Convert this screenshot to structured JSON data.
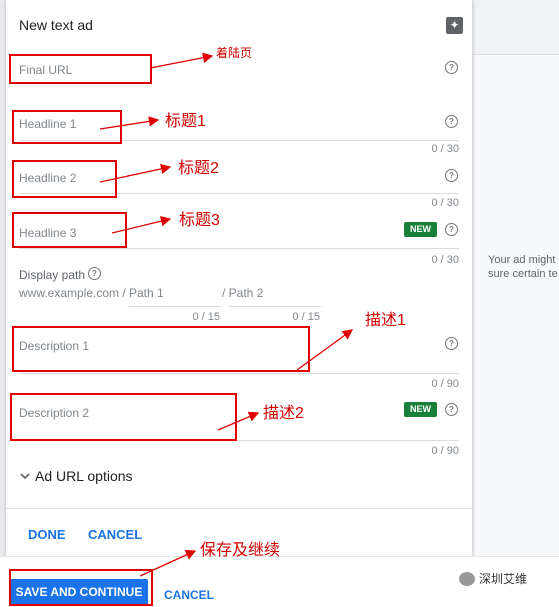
{
  "ad": {
    "title": "New text ad",
    "final_url_label": "Final URL",
    "headline1_label": "Headline 1",
    "headline1_count": "0 / 30",
    "headline2_label": "Headline 2",
    "headline2_count": "0 / 30",
    "headline3_label": "Headline 3",
    "headline3_badge": "NEW",
    "headline3_count": "0 / 30",
    "display_path_label": "Display path",
    "display_path_domain": "www.example.com /",
    "path1_label": "Path 1",
    "path2_label": "/ Path 2",
    "path1_count": "0 / 15",
    "path2_count": "0 / 15",
    "description1_label": "Description 1",
    "description1_count": "0 / 90",
    "description2_label": "Description 2",
    "description2_badge": "NEW",
    "description2_count": "0 / 90",
    "url_options_label": "Ad URL options",
    "done_label": "DONE",
    "cancel_label": "CANCEL"
  },
  "preview": {
    "line1": "Your ad might",
    "line2": "sure certain te"
  },
  "bottom": {
    "save_continue_label": "SAVE AND CONTINUE",
    "cancel_label": "CANCEL"
  },
  "annotations": {
    "landing_page": "着陆页",
    "headline1": "标题1",
    "headline2": "标题2",
    "headline3": "标题3",
    "description1": "描述1",
    "description2": "描述2",
    "save_continue": "保存及继续"
  },
  "watermark": {
    "text": "深圳艾维"
  },
  "colors": {
    "accent": "#1a73e8",
    "badge": "#188038",
    "annotation": "#e00000"
  }
}
